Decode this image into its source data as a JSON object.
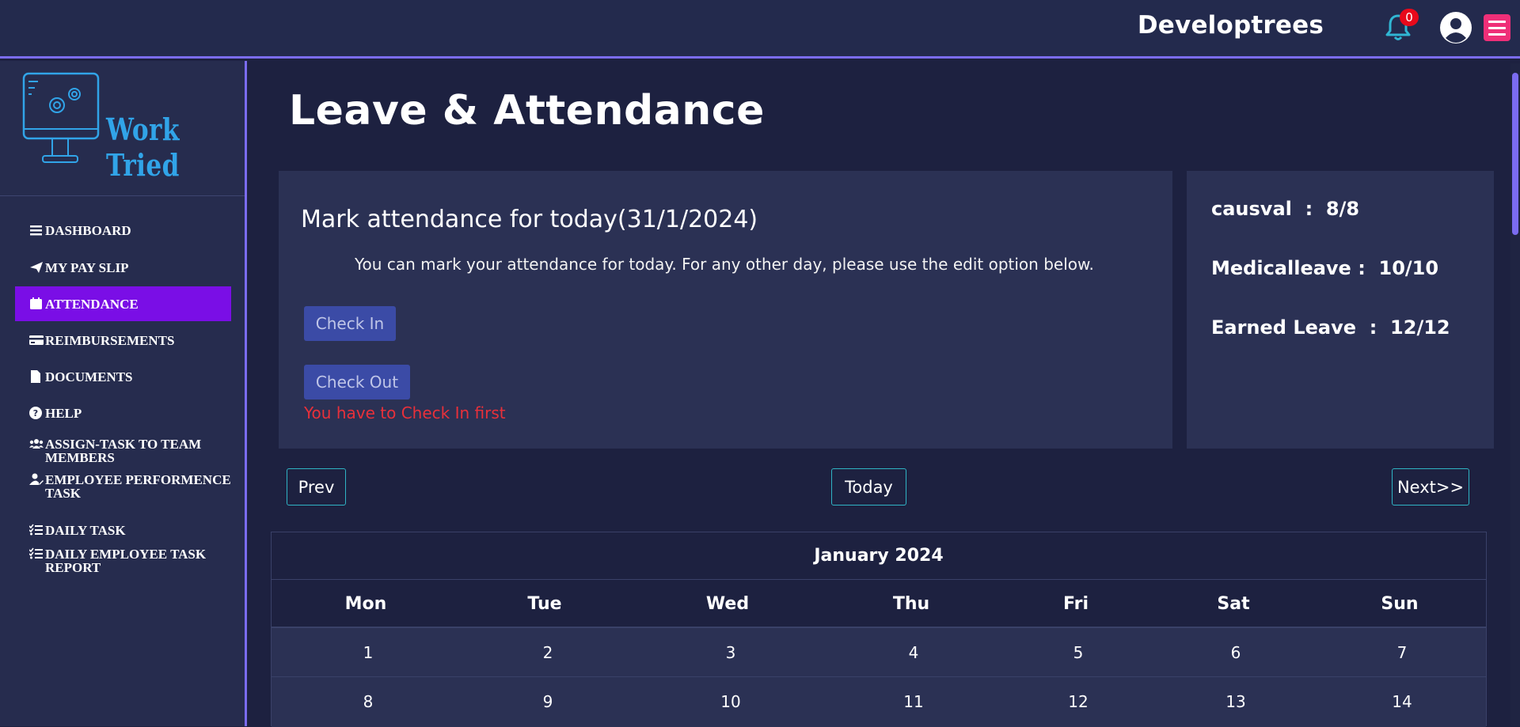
{
  "header": {
    "brand": "Developtrees",
    "notification_count": "0"
  },
  "sidebar": {
    "logo_text": "Work Tried",
    "items": [
      {
        "label": "DASHBOARD",
        "icon": "bars-icon"
      },
      {
        "label": "MY PAY SLIP",
        "icon": "paper-plane-icon"
      },
      {
        "label": "ATTENDANCE",
        "icon": "calendar-icon",
        "active": true
      },
      {
        "label": "REIMBURSEMENTS",
        "icon": "credit-card-icon"
      },
      {
        "label": "DOCUMENTS",
        "icon": "file-icon"
      },
      {
        "label": "HELP",
        "icon": "question-circle-icon"
      },
      {
        "label": "ASSIGN-TASK TO TEAM MEMBERS",
        "icon": "users-icon"
      },
      {
        "label": "EMPLOYEE PERFORMENCE TASK",
        "icon": "user-edit-icon"
      },
      {
        "label": "DAILY TASK",
        "icon": "list-check-icon"
      },
      {
        "label": "DAILY EMPLOYEE TASK REPORT",
        "icon": "list-check-icon"
      }
    ]
  },
  "main": {
    "title": "Leave & Attendance",
    "attendance": {
      "title": "Mark attendance for today(31/1/2024)",
      "description": "You can mark your attendance for today. For any other day, please use the edit option below.",
      "check_in_label": "Check In",
      "check_out_label": "Check Out",
      "warning": "You have to Check In first"
    },
    "leave_balance": [
      {
        "name": "causval",
        "sep": "  :  ",
        "value": "8/8"
      },
      {
        "name": "Medicalleave",
        "sep": " :  ",
        "value": "10/10"
      },
      {
        "name": "Earned Leave",
        "sep": "  :  ",
        "value": "12/12"
      }
    ],
    "calendar": {
      "prev_label": "Prev",
      "today_label": "Today",
      "next_label": "Next>>",
      "month": "January 2024",
      "day_names": [
        "Mon",
        "Tue",
        "Wed",
        "Thu",
        "Fri",
        "Sat",
        "Sun"
      ],
      "weeks": [
        [
          "1",
          "2",
          "3",
          "4",
          "5",
          "6",
          "7"
        ],
        [
          "8",
          "9",
          "10",
          "11",
          "12",
          "13",
          "14"
        ]
      ]
    }
  },
  "colors": {
    "accent": "#7b6cf0",
    "active_nav": "#7a0ee6",
    "menu_button": "#ef2f78",
    "warning": "#e8303a",
    "button": "#3b4ba6"
  }
}
